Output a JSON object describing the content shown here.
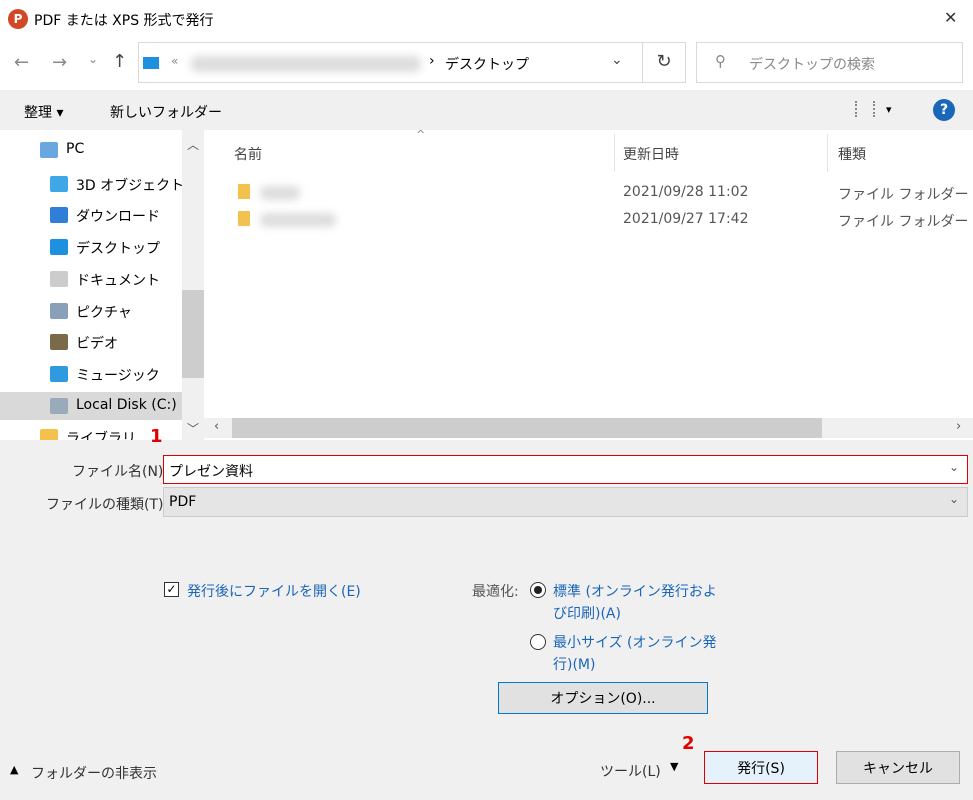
{
  "window": {
    "title": "PDF または XPS 形式で発行",
    "close": "✕"
  },
  "nav": {
    "back": "←",
    "forward": "→",
    "recent": "⌄",
    "up": "↑",
    "address_prefix": "«",
    "address_sep": "›",
    "address_current": "デスクトップ",
    "refresh": "↻",
    "search_placeholder": "デスクトップの検索"
  },
  "toolbar": {
    "organize": "整理 ▾",
    "new_folder": "新しいフォルダー",
    "view": "▾",
    "help": "?"
  },
  "sidebar": {
    "items": [
      {
        "label": "PC",
        "icon": "pc-icon"
      },
      {
        "label": "3D オブジェクト",
        "icon": "cube-icon"
      },
      {
        "label": "ダウンロード",
        "icon": "download-icon"
      },
      {
        "label": "デスクトップ",
        "icon": "desktop-icon"
      },
      {
        "label": "ドキュメント",
        "icon": "document-icon"
      },
      {
        "label": "ピクチャ",
        "icon": "picture-icon"
      },
      {
        "label": "ビデオ",
        "icon": "video-icon"
      },
      {
        "label": "ミュージック",
        "icon": "music-icon"
      },
      {
        "label": "Local Disk (C:)",
        "icon": "disk-icon"
      },
      {
        "label": "ライブラリ",
        "icon": "folder-icon"
      }
    ],
    "selected": 8
  },
  "files": {
    "columns": [
      "名前",
      "更新日時",
      "種類"
    ],
    "rows": [
      {
        "date": "2021/09/28 11:02",
        "type": "ファイル フォルダー"
      },
      {
        "date": "2021/09/27 17:42",
        "type": "ファイル フォルダー"
      }
    ]
  },
  "form": {
    "filename_label": "ファイル名(N):",
    "filename_value": "プレゼン資料",
    "filetype_label": "ファイルの種類(T):",
    "filetype_value": "PDF",
    "open_after": "発行後にファイルを開く(E)",
    "open_after_checked": true,
    "optimize_label": "最適化:",
    "opt_standard_1": "標準 (オンライン発行およ",
    "opt_standard_2": "び印刷)(A)",
    "opt_min_1": "最小サイズ (オンライン発",
    "opt_min_2": "行)(M)",
    "opt_selected": "standard",
    "options_button": "オプション(O)..."
  },
  "footer": {
    "hide_folders": "フォルダーの非表示",
    "tools": "ツール(L)",
    "publish": "発行(S)",
    "cancel": "キャンセル"
  },
  "annotations": {
    "step1": "1",
    "step2": "2",
    "color": "#e00000"
  }
}
